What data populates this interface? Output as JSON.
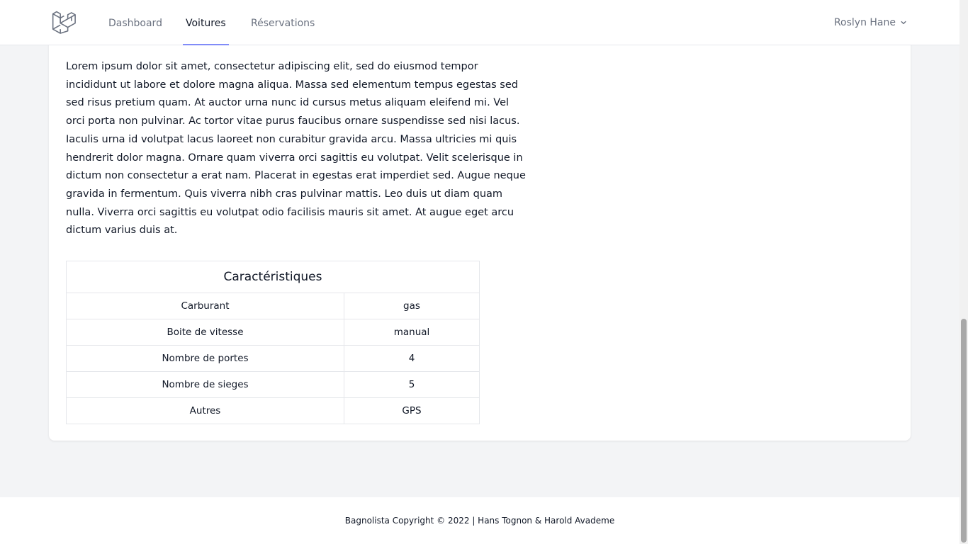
{
  "nav": {
    "logo_icon": "laravel-cube-icon",
    "links": [
      {
        "label": "Dashboard"
      },
      {
        "label": "Voitures",
        "active": true
      },
      {
        "label": "Réservations"
      }
    ],
    "user_name": "Roslyn Hane"
  },
  "car": {
    "description": "Lorem ipsum dolor sit amet, consectetur adipiscing elit, sed do eiusmod tempor incididunt ut labore et dolore magna aliqua. Massa sed elementum tempus egestas sed sed risus pretium quam. At auctor urna nunc id cursus metus aliquam eleifend mi. Vel orci porta non pulvinar. Ac tortor vitae purus faucibus ornare suspendisse sed nisi lacus. Iaculis urna id volutpat lacus laoreet non curabitur gravida arcu. Massa ultricies mi quis hendrerit dolor magna. Ornare quam viverra orci sagittis eu volutpat. Velit scelerisque in dictum non consectetur a erat nam. Placerat in egestas erat imperdiet sed. Augue neque gravida in fermentum. Quis viverra nibh cras pulvinar mattis. Leo duis ut diam quam nulla. Viverra orci sagittis eu volutpat odio facilisis mauris sit amet. At augue eget arcu dictum varius duis at.",
    "specs": {
      "title": "Caractéristiques",
      "rows": [
        {
          "label": "Carburant",
          "value": "gas"
        },
        {
          "label": "Boite de vitesse",
          "value": "manual"
        },
        {
          "label": "Nombre de portes",
          "value": "4"
        },
        {
          "label": "Nombre de sieges",
          "value": "5"
        },
        {
          "label": "Autres",
          "value": "GPS"
        }
      ]
    }
  },
  "footer": {
    "text": "Bagnolista Copyright © 2022 | Hans Tognon & Harold Avademe"
  },
  "colors": {
    "active_tab_underline": "#818cf8",
    "page_background": "#f3f4f6"
  }
}
